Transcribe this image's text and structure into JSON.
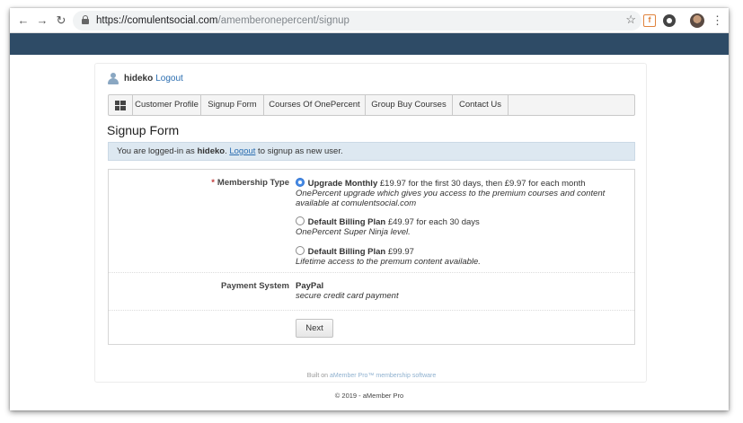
{
  "browser": {
    "url_host": "https://comulentsocial.com",
    "url_path": "/amemberonepercent/signup",
    "ext_f_label": "f"
  },
  "user": {
    "name": "hideko",
    "logout": "Logout"
  },
  "menu": {
    "items": [
      "Customer Profile",
      "Signup Form",
      "Courses Of OnePercent",
      "Group Buy Courses",
      "Contact Us"
    ]
  },
  "page": {
    "title": "Signup Form"
  },
  "notice": {
    "pre": "You are logged-in as ",
    "user": "hideko",
    "dot": ". ",
    "link": "Logout",
    "post": " to signup as new user."
  },
  "form": {
    "required_mark": "*",
    "membership_label": "Membership Type",
    "options": [
      {
        "title": "Upgrade Monthly",
        "price": " £19.97 for the first 30 days, then £9.97 for each month",
        "desc": "OnePercent upgrade which gives you access to the premium courses and content available at comulentsocial.com",
        "checked": true
      },
      {
        "title": "Default Billing Plan",
        "price": " £49.97 for each 30 days",
        "desc": "OnePercent Super Ninja level.",
        "checked": false
      },
      {
        "title": "Default Billing Plan",
        "price": " £99.97",
        "desc": "Lifetime access to the premum content available.",
        "checked": false
      }
    ],
    "payment_label": "Payment System",
    "payment_name": "PayPal",
    "payment_desc": "secure credit card payment",
    "next_button": "Next"
  },
  "footer": {
    "built_pre": "Built on ",
    "built_link": "aMember Pro™ membership software",
    "copyright": "© 2019 - aMember Pro"
  },
  "colors": {
    "header_bar": "#2e4b66",
    "notice_bg": "#dde8f1",
    "link": "#2a6db0"
  }
}
